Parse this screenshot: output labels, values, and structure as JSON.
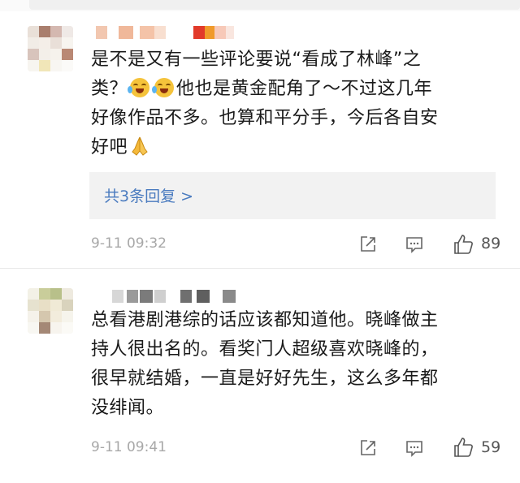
{
  "comments": [
    {
      "text_lines": [
        "是不是又有一些评论要说“看成了林峰”之",
        "类？",
        "他也是黄金配角了～不过这几年",
        "好像作品不多。也算和平分手，今后各自安",
        "好吧"
      ],
      "replies_label": "共3条回复 >",
      "timestamp": "9-11 09:32",
      "likes": "89"
    },
    {
      "text_lines": [
        "总看港剧港综的话应该都知道他。晓峰做主",
        "持人很出名的。看奖门人超级喜欢晓峰的，",
        "很早就结婚，一直是好好先生，这么多年都",
        "没绯闻。"
      ],
      "timestamp": "9-11 09:41",
      "likes": "59"
    }
  ],
  "icons": {
    "share": "share-icon",
    "comment": "comment-icon",
    "like": "thumbs-up-icon",
    "emoji": "laughing-crying-emoji-icon",
    "pray": "praying-hands-emoji-icon"
  },
  "colors": {
    "link": "#4a7bbf",
    "meta": "#a8a8a8",
    "reply_bg": "#f2f2f2"
  }
}
